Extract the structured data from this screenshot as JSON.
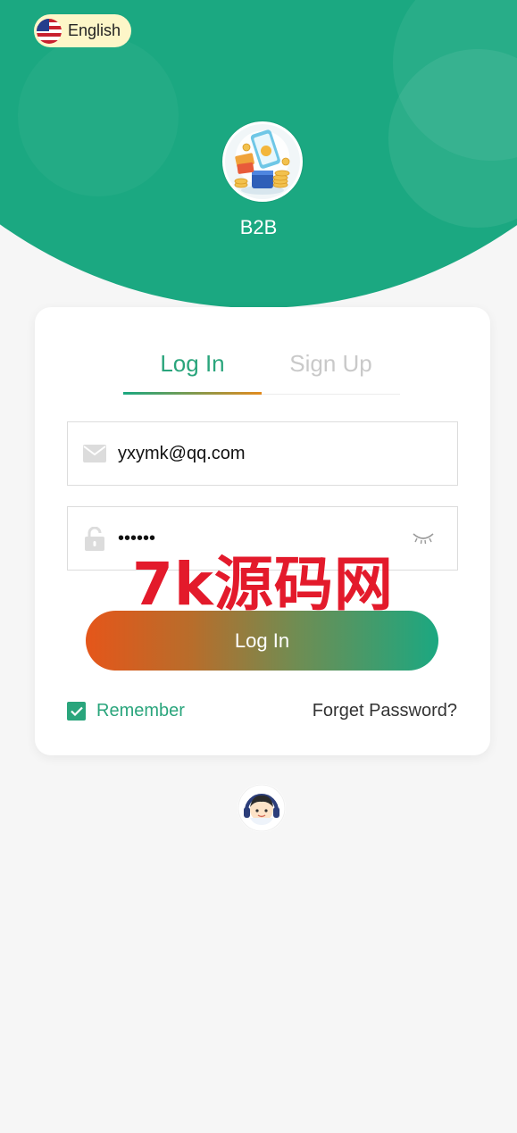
{
  "header": {
    "language": {
      "label": "English",
      "flag_icon": "us-flag-icon"
    },
    "brand_name": "B2B",
    "bg_color": "#1ba881"
  },
  "auth_card": {
    "tabs": [
      {
        "label": "Log In",
        "active": true
      },
      {
        "label": "Sign Up",
        "active": false
      }
    ],
    "email": {
      "icon": "mail-icon",
      "value": "yxymk@qq.com"
    },
    "password": {
      "icon": "lock-icon",
      "value": "••••••",
      "toggle_icon": "eye-closed-icon"
    },
    "login_button": "Log In",
    "remember": {
      "label": "Remember",
      "checked": true
    },
    "forgot_password": "Forget Password?"
  },
  "watermark": "7k源码网",
  "support_icon": "customer-service-icon",
  "colors": {
    "accent": "#2aa57c",
    "button_start": "#e5561a",
    "button_end": "#1ba881"
  }
}
